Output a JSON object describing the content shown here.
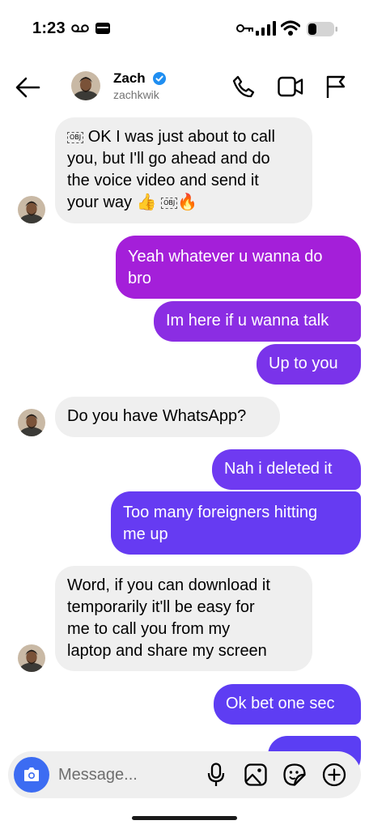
{
  "status_bar": {
    "time": "1:23"
  },
  "header": {
    "name": "Zach",
    "username": "zachkwik"
  },
  "messages": {
    "m1": {
      "line1": "OK I was just about to call",
      "line2": "you, but I'll go ahead and do",
      "line3": "the voice video and send it",
      "line4": "your way 👍",
      "line4_end": "🔥",
      "obj": "OBJ"
    },
    "m2": {
      "line1": "Yeah whatever u wanna do",
      "line2": "bro"
    },
    "m3": {
      "text": "Im here if u wanna talk"
    },
    "m4": {
      "text": "Up to you"
    },
    "m5": {
      "text": "Do you have WhatsApp?"
    },
    "m6": {
      "text": "Nah i deleted it"
    },
    "m7": {
      "line1": "Too many foreigners hitting",
      "line2": "me up"
    },
    "m8": {
      "line1": "Word, if you can download it",
      "line2": "temporarily it'll be easy for",
      "line3": "me to call you from my",
      "line4": "laptop and share my screen"
    },
    "m9": {
      "text": "Ok bet one sec"
    }
  },
  "composer": {
    "placeholder": "Message..."
  },
  "colors": {
    "incoming_bubble": "#efefef",
    "outgoing_magenta": "#a41fd9",
    "outgoing_purple": "#6f3af1",
    "outgoing_violet": "#5e3df3",
    "camera_button": "#3c6cf2",
    "verified": "#1f8ef1"
  }
}
